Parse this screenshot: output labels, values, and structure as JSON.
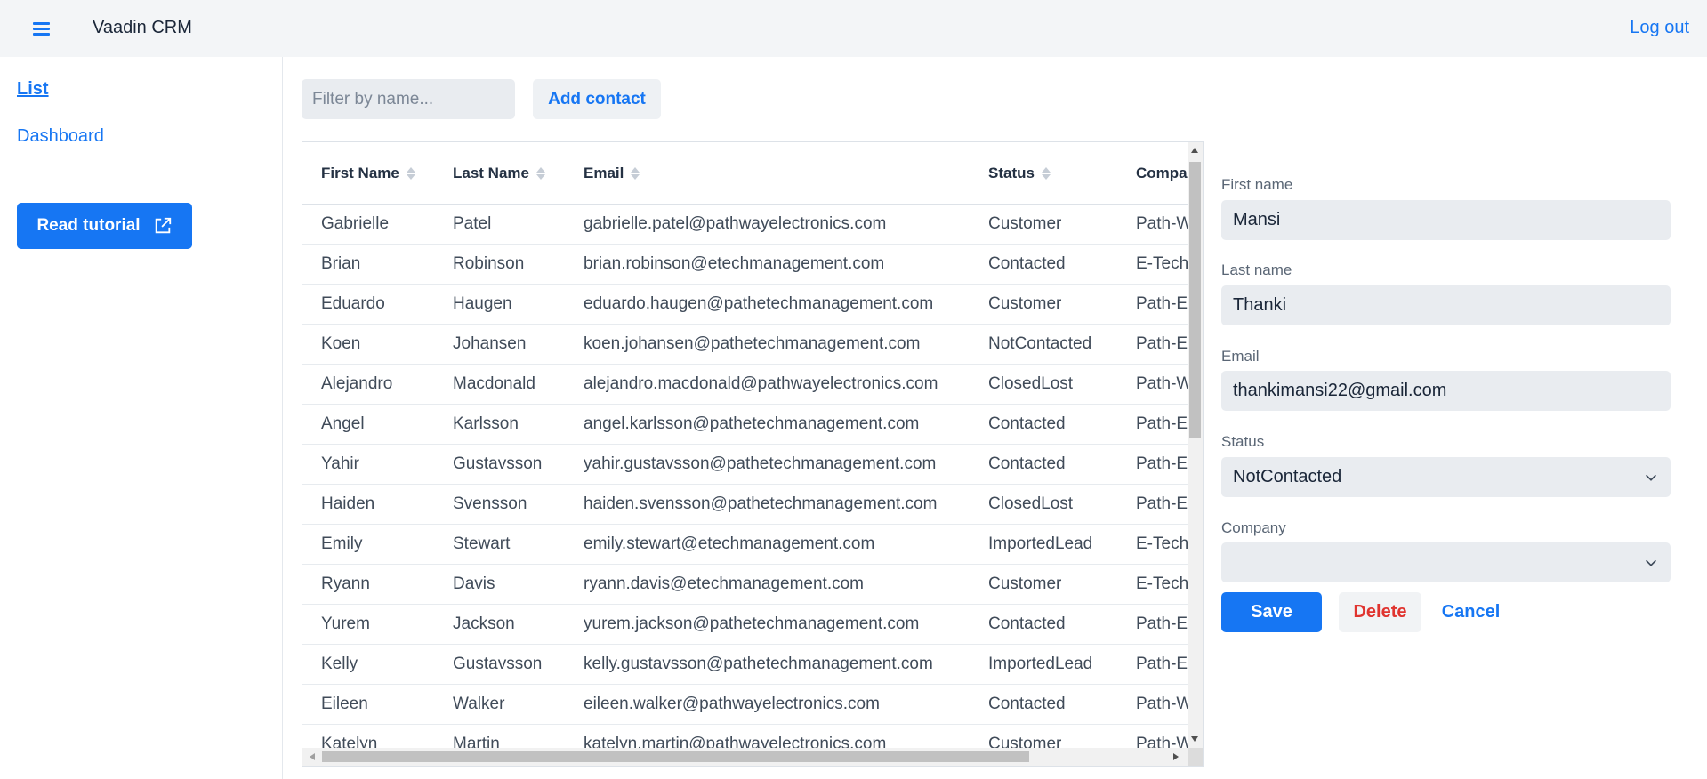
{
  "app": {
    "title": "Vaadin CRM",
    "logout_label": "Log out"
  },
  "drawer": {
    "nav": [
      {
        "label": "List",
        "active": true
      },
      {
        "label": "Dashboard",
        "active": false
      }
    ],
    "tutorial_label": "Read tutorial"
  },
  "toolbar": {
    "filter_placeholder": "Filter by name...",
    "filter_value": "",
    "add_label": "Add contact"
  },
  "grid": {
    "columns": [
      "First Name",
      "Last Name",
      "Email",
      "Status",
      "Compa"
    ],
    "rows": [
      [
        "Gabrielle",
        "Patel",
        "gabrielle.patel@pathwayelectronics.com",
        "Customer",
        "Path-W"
      ],
      [
        "Brian",
        "Robinson",
        "brian.robinson@etechmanagement.com",
        "Contacted",
        "E-Tech"
      ],
      [
        "Eduardo",
        "Haugen",
        "eduardo.haugen@pathetechmanagement.com",
        "Customer",
        "Path-E"
      ],
      [
        "Koen",
        "Johansen",
        "koen.johansen@pathetechmanagement.com",
        "NotContacted",
        "Path-E"
      ],
      [
        "Alejandro",
        "Macdonald",
        "alejandro.macdonald@pathwayelectronics.com",
        "ClosedLost",
        "Path-W"
      ],
      [
        "Angel",
        "Karlsson",
        "angel.karlsson@pathetechmanagement.com",
        "Contacted",
        "Path-E"
      ],
      [
        "Yahir",
        "Gustavsson",
        "yahir.gustavsson@pathetechmanagement.com",
        "Contacted",
        "Path-E"
      ],
      [
        "Haiden",
        "Svensson",
        "haiden.svensson@pathetechmanagement.com",
        "ClosedLost",
        "Path-E"
      ],
      [
        "Emily",
        "Stewart",
        "emily.stewart@etechmanagement.com",
        "ImportedLead",
        "E-Tech"
      ],
      [
        "Ryann",
        "Davis",
        "ryann.davis@etechmanagement.com",
        "Customer",
        "E-Tech"
      ],
      [
        "Yurem",
        "Jackson",
        "yurem.jackson@pathetechmanagement.com",
        "Contacted",
        "Path-E"
      ],
      [
        "Kelly",
        "Gustavsson",
        "kelly.gustavsson@pathetechmanagement.com",
        "ImportedLead",
        "Path-E"
      ],
      [
        "Eileen",
        "Walker",
        "eileen.walker@pathwayelectronics.com",
        "Contacted",
        "Path-W"
      ],
      [
        "Katelyn",
        "Martin",
        "katelyn.martin@pathwayelectronics.com",
        "Customer",
        "Path-W"
      ]
    ]
  },
  "form": {
    "first_name": {
      "label": "First name",
      "value": "Mansi"
    },
    "last_name": {
      "label": "Last name",
      "value": "Thanki"
    },
    "email": {
      "label": "Email",
      "value": "thankimansi22@gmail.com"
    },
    "status": {
      "label": "Status",
      "value": "NotContacted"
    },
    "company": {
      "label": "Company",
      "value": ""
    },
    "save_label": "Save",
    "delete_label": "Delete",
    "cancel_label": "Cancel"
  },
  "colors": {
    "primary": "#1676f3",
    "danger": "#e0342f",
    "navbar_bg": "#f3f5f7",
    "field_bg": "#e9ecf0"
  },
  "icons": [
    "menu-icon",
    "external-link-icon",
    "sort-icon",
    "chevron-down-icon"
  ]
}
